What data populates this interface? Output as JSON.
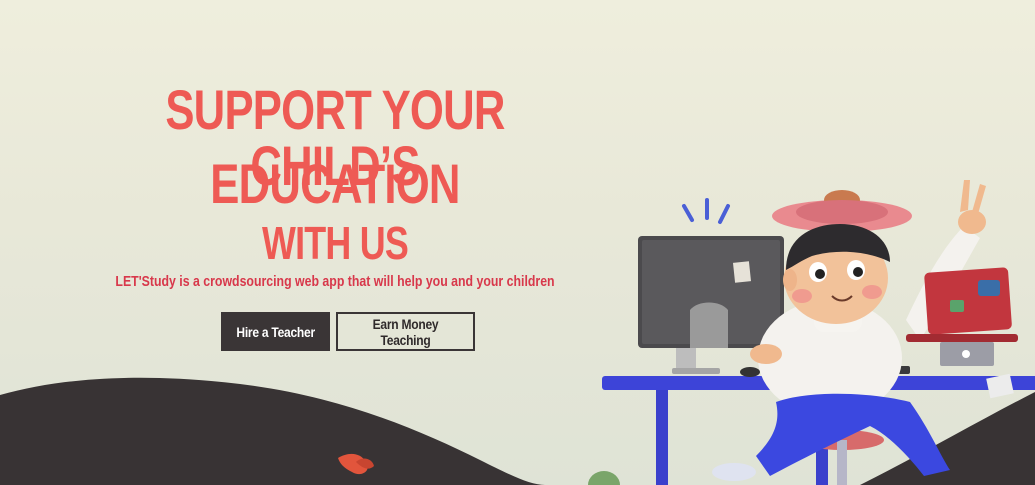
{
  "hero": {
    "headline_line1": "SUPPORT YOUR CHILD’S",
    "headline_line2": "EDUCATION",
    "headline_line3": "WITH US",
    "tagline": "LET'Study is a crowdsourcing web app that will help you and your children"
  },
  "cta": {
    "hire_label": "Hire a Teacher",
    "earn_label": "Earn Money Teaching"
  },
  "colors": {
    "accent": "#ee5a54",
    "tagline": "#d8384b",
    "dark": "#3a3536",
    "desk": "#3d44d8"
  },
  "illustration": {
    "subject": "boy-at-computer-desk-illustration"
  }
}
